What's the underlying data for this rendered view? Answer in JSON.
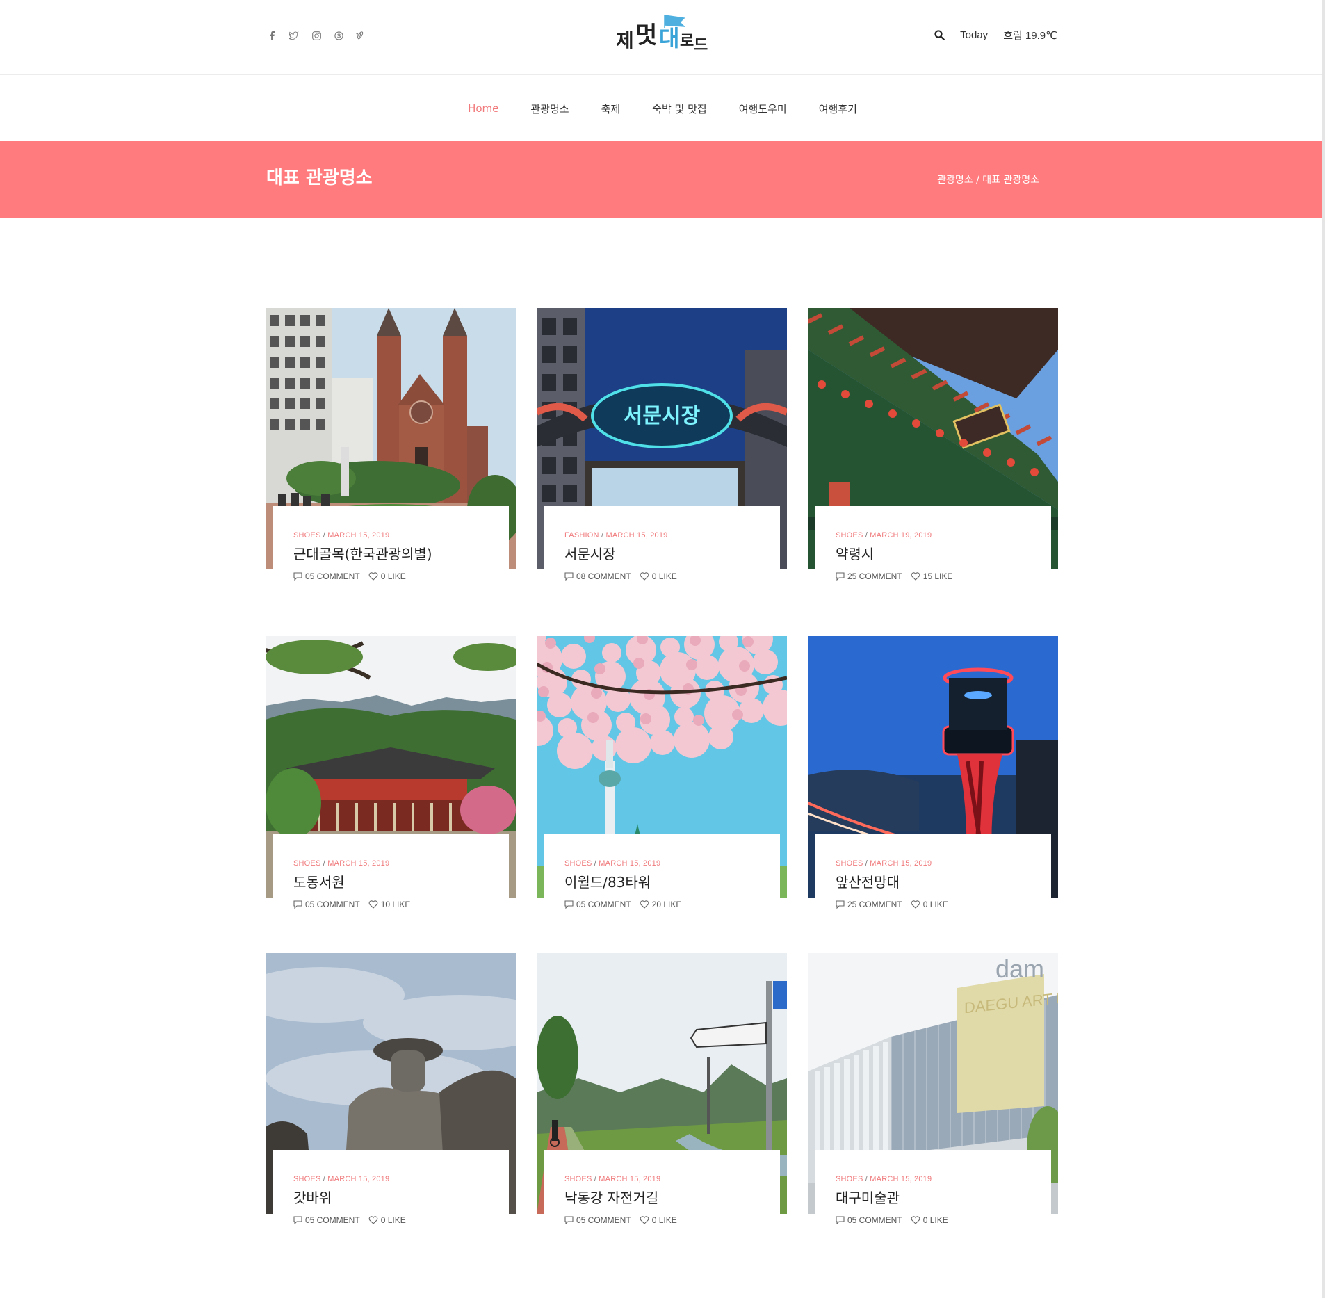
{
  "header": {
    "social_icons": [
      "facebook-icon",
      "twitter-icon",
      "instagram-icon",
      "skype-icon",
      "vimeo-icon"
    ],
    "logo_text": [
      "제",
      "멋",
      "대",
      "로",
      "드"
    ],
    "today_label": "Today",
    "weather": "흐림 19.9℃"
  },
  "nav": {
    "items": [
      {
        "label": "Home",
        "active": true
      },
      {
        "label": "관광명소",
        "active": false
      },
      {
        "label": "축제",
        "active": false
      },
      {
        "label": "숙박 및 맛집",
        "active": false
      },
      {
        "label": "여행도우미",
        "active": false
      },
      {
        "label": "여행후기",
        "active": false
      }
    ]
  },
  "banner": {
    "title": "대표 관광명소",
    "breadcrumb": "관광명소 / 대표 관광명소"
  },
  "colors": {
    "accent": "#ff7b7e",
    "meta": "#f07a7c"
  },
  "cards": [
    {
      "category": "SHOES",
      "date": "MARCH 15, 2019",
      "title": "근대골목(한국관광의별)",
      "comments": "05 COMMENT",
      "likes": "0 LIKE",
      "image": "church"
    },
    {
      "category": "FASHION",
      "date": "MARCH 15, 2019",
      "title": "서문시장",
      "comments": "08 COMMENT",
      "likes": "0 LIKE",
      "image": "market"
    },
    {
      "category": "SHOES",
      "date": "MARCH 19, 2019",
      "title": "약령시",
      "comments": "25 COMMENT",
      "likes": "15 LIKE",
      "image": "gate"
    },
    {
      "category": "SHOES",
      "date": "MARCH 15, 2019",
      "title": "도동서원",
      "comments": "05 COMMENT",
      "likes": "10 LIKE",
      "image": "temple"
    },
    {
      "category": "SHOES",
      "date": "MARCH 15, 2019",
      "title": "이월드/83타워",
      "comments": "05 COMMENT",
      "likes": "20 LIKE",
      "image": "blossom"
    },
    {
      "category": "SHOES",
      "date": "MARCH 15, 2019",
      "title": "앞산전망대",
      "comments": "25 COMMENT",
      "likes": "0 LIKE",
      "image": "observatory"
    },
    {
      "category": "SHOES",
      "date": "MARCH 15, 2019",
      "title": "갓바위",
      "comments": "05 COMMENT",
      "likes": "0 LIKE",
      "image": "buddha"
    },
    {
      "category": "SHOES",
      "date": "MARCH 15, 2019",
      "title": "낙동강 자전거길",
      "comments": "05 COMMENT",
      "likes": "0 LIKE",
      "image": "bikepath"
    },
    {
      "category": "SHOES",
      "date": "MARCH 15, 2019",
      "title": "대구미술관",
      "comments": "05 COMMENT",
      "likes": "0 LIKE",
      "image": "museum"
    }
  ],
  "museum_sign": "DAEGU ART MUSEUM",
  "museum_dam": "dam",
  "market_sign": "서문시장"
}
